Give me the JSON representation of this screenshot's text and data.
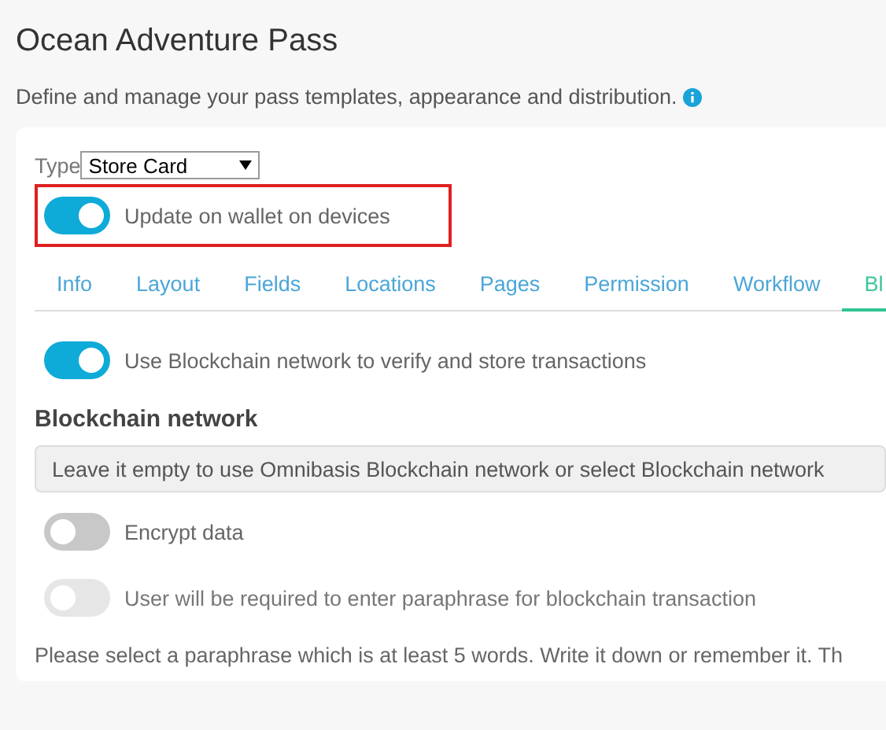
{
  "title": "Ocean Adventure Pass",
  "subtitle": "Define and manage your pass templates, appearance and distribution.",
  "type_field": {
    "label": "Type",
    "value": "Store Card"
  },
  "wallet_toggle": {
    "label": "Update on wallet on devices",
    "on": true,
    "highlighted": true
  },
  "tabs": [
    {
      "label": "Info",
      "selected": false
    },
    {
      "label": "Layout",
      "selected": false
    },
    {
      "label": "Fields",
      "selected": false
    },
    {
      "label": "Locations",
      "selected": false
    },
    {
      "label": "Pages",
      "selected": false
    },
    {
      "label": "Permission",
      "selected": false
    },
    {
      "label": "Workflow",
      "selected": false
    },
    {
      "label": "Bl",
      "selected": true
    }
  ],
  "blockchain_toggle": {
    "label": "Use Blockchain network to verify and store transactions",
    "on": true,
    "disabled": false
  },
  "network": {
    "heading": "Blockchain network",
    "placeholder": "Leave it empty to use Omnibasis Blockchain network or select Blockchain network"
  },
  "options": [
    {
      "label": "Encrypt data",
      "on": false,
      "disabled": false
    },
    {
      "label": "User will be required to enter paraphrase for blockchain transaction",
      "on": false,
      "disabled": true
    }
  ],
  "note": "Please select a paraphrase which is at least 5 words. Write it down or remember it. Th"
}
